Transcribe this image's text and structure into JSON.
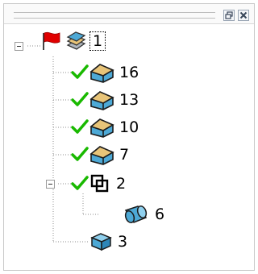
{
  "window": {
    "buttons": [
      {
        "name": "restore-icon"
      },
      {
        "name": "close-icon"
      }
    ]
  },
  "tree": {
    "root": {
      "label": "1",
      "icons": [
        "red-flag-icon",
        "part-stack-icon"
      ],
      "selected": true
    },
    "children": [
      {
        "label": "16",
        "status": "check-icon",
        "type": "solid-face-icon"
      },
      {
        "label": "13",
        "status": "check-icon",
        "type": "solid-face-icon"
      },
      {
        "label": "10",
        "status": "check-icon",
        "type": "solid-face-icon"
      },
      {
        "label": "7",
        "status": "check-icon",
        "type": "solid-face-icon"
      },
      {
        "label": "2",
        "status": "check-icon",
        "type": "boolean-overlap-icon",
        "expanded": true,
        "children": [
          {
            "label": "6",
            "type": "cylinder-icon"
          }
        ]
      },
      {
        "label": "3",
        "type": "cube-icon"
      }
    ]
  },
  "colors": {
    "check": "#19b900",
    "flag": "#e00000",
    "face_tan": "#e8c478",
    "face_blue": "#4da9d6",
    "tree_line": "#8c8c8c"
  }
}
